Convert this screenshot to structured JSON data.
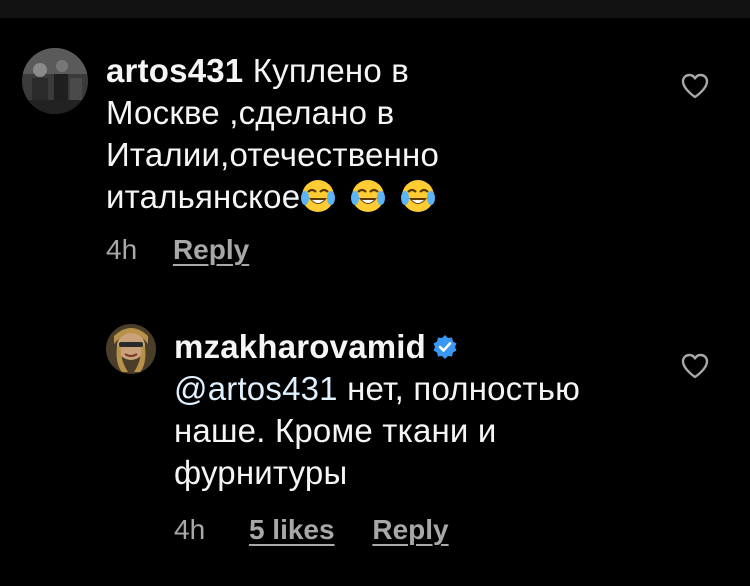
{
  "comments": [
    {
      "username": "artos431",
      "text_lines": [
        "Куплено в",
        "Москве ,сделано в",
        "Италии,отечественно",
        "итальянское"
      ],
      "emojis": [
        "face-with-tears-of-joy",
        "face-with-tears-of-joy",
        "face-with-tears-of-joy"
      ],
      "time": "4h",
      "reply_label": "Reply"
    },
    {
      "username": "mzakharovamid",
      "verified": true,
      "mention": "@artos431",
      "text_lines": [
        " нет, полностью",
        "наше. Кроме ткани и",
        "фурнитуры"
      ],
      "time": "4h",
      "likes_label": "5 likes",
      "reply_label": "Reply"
    }
  ],
  "icons": {
    "like": "heart-outline-icon",
    "verified": "verified-badge-icon"
  },
  "colors": {
    "background": "#000000",
    "text": "#f5f5f5",
    "meta": "#a8a8a8",
    "verified": "#3897f0",
    "emoji": "#ffcc33"
  }
}
